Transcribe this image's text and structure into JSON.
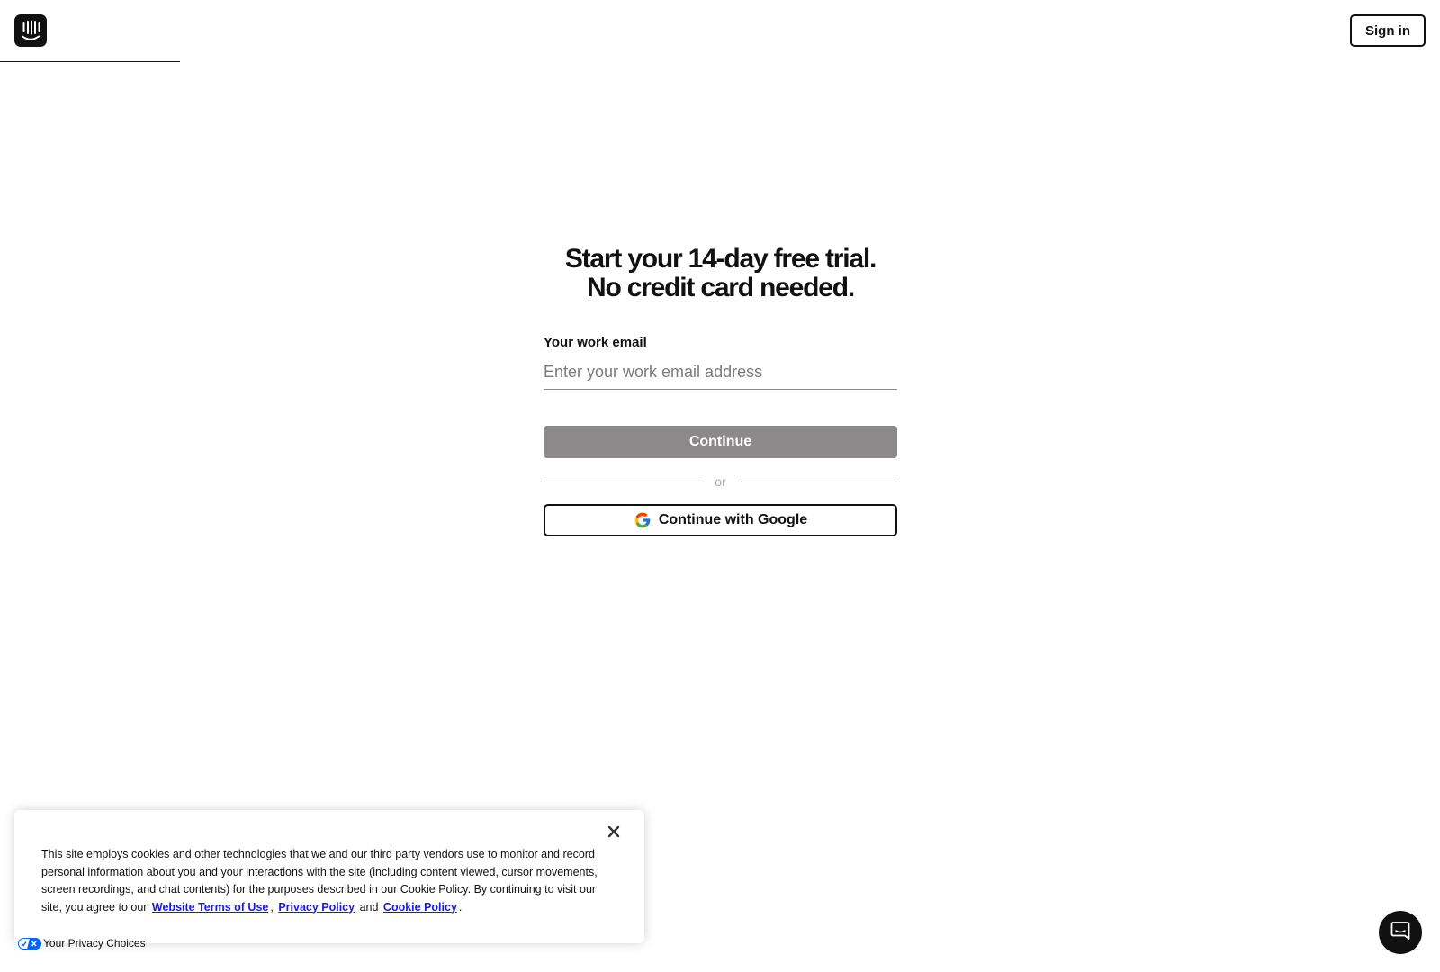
{
  "header": {
    "logo_icon": "intercom-logo-icon",
    "signin_label": "Sign in"
  },
  "main": {
    "headline_line1": "Start your 14-day free trial.",
    "headline_line2": "No credit card needed.",
    "email_label": "Your work email",
    "email_placeholder": "Enter your work email address",
    "email_value": "",
    "continue_label": "Continue",
    "divider_text": "or",
    "google_label": "Continue with Google",
    "google_icon": "google-g-icon"
  },
  "cookie_banner": {
    "close_icon": "close-icon",
    "text_before": "This site employs cookies and other technologies that we and our third party vendors use to monitor and record personal information about you and your interactions with the site (including content viewed, cursor movements, screen recordings, and chat contents) for the purposes described in our Cookie Policy. By continuing to visit our site, you agree to our ",
    "link_terms": "Website Terms of Use",
    "sep_comma": ",",
    "link_privacy": "Privacy Policy",
    "sep_and": "and",
    "link_cookie": "Cookie Policy",
    "end_period": "."
  },
  "privacy_choices": {
    "label": "Your Privacy Choices",
    "icon": "privacy-options-icon"
  },
  "chat": {
    "icon": "chat-bubble-icon"
  },
  "colors": {
    "text": "#111111",
    "continue_disabled": "#8b8989",
    "link": "#1a1ae6",
    "placeholder": "#7a7a80"
  }
}
